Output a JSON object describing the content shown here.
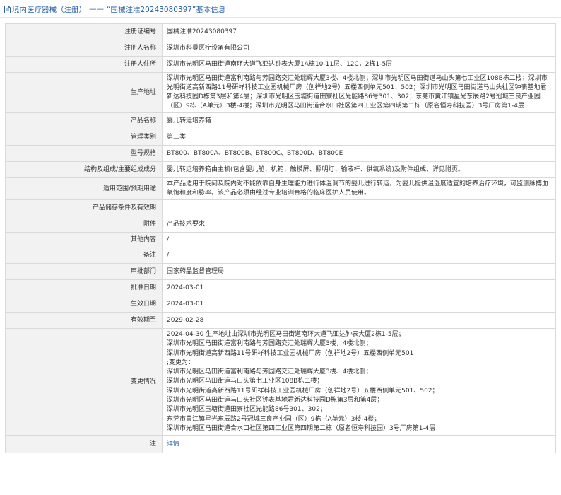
{
  "breadcrumb": {
    "part1": "境内医疗器械（注册）",
    "separator": "——",
    "part2": "“国械注准20243080397”基本信息"
  },
  "rows": [
    {
      "key": "注册证编号",
      "value": "国械注准20243080397"
    },
    {
      "key": "注册人名称",
      "value": "深圳市科曼医疗设备有限公司"
    },
    {
      "key": "注册人住所",
      "value": "深圳市光明区马田街道南环大道飞亚达钟表大厦1A栋10-11层、12C，2栋1-5层"
    },
    {
      "key": "生产地址",
      "value": "深圳市光明区马田街道富利南路与芳园路交汇处瑞辉大厦3楼、4楼北侧；深圳市光明区马田街道马山头第七工业区108B栋二楼；深圳市光明街道高新西路11号研祥科技工业园机械厂房（创祥地2号）五楼西侧单元501、502；深圳市光明区马田街道马山头社区钟表基地君新达科技园D栋第3层和第4层；深圳市光明区玉塘街道田寮社区光能路86号301、302；东莞市黄江镇星光东辰路2号冠城三良产业园（区）9栋（A单元）3楼-4楼；深圳市光明区马田街道合水口社区第四工业区第四期第二栋（原名恒寿科技园）3号厂房第1-4层"
    },
    {
      "key": "产品名称",
      "value": "婴儿转运培养箱"
    },
    {
      "key": "管理类别",
      "value": "第三类"
    },
    {
      "key": "型号规格",
      "value": "BT800、BT800A、BT800B、BT800C、BT800D、BT800E"
    },
    {
      "key": "结构及组成/主要组成成分",
      "value": "婴儿转运培养箱由主机(包含婴儿舱、机箱、触摸屏、照明灯、输液杆、供氧系统)及附件组成，详见附页。"
    },
    {
      "key": "适用范围/预期用途",
      "value": "本产品适用于院间及院内对不能依靠自身生理能力进行体温调节的婴儿进行转运，为婴儿提供温湿度适宜的培养治疗环境，可监测脉搏血氧饱和度和脉率。该产品必须由经过专业培训合格的临床医护人员使用。"
    },
    {
      "key": "产品储存条件及有效期",
      "value": ""
    },
    {
      "key": "附件",
      "value": "产品技术要求"
    },
    {
      "key": "其他内容",
      "value": "/"
    },
    {
      "key": "备注",
      "value": "/"
    },
    {
      "key": "审批部门",
      "value": "国家药品监督管理局"
    },
    {
      "key": "批准日期",
      "value": "2024-03-01"
    },
    {
      "key": "生效日期",
      "value": "2024-03-01"
    },
    {
      "key": "有效期至",
      "value": "2029-02-28"
    }
  ],
  "changes": {
    "key": "变更情况",
    "lines": [
      "2024-04-30 生产地址由深圳市光明区马田街道南环大道飞亚达钟表大厦2栋1-5层；",
      "深圳市光明区马田街道富利南路与芳园路交汇处瑞辉大厦3楼，4楼北侧；",
      "深圳市光明街道高新西路11号研祥科技工业园机械厂房（创祥地2号）五楼西侧单元501",
      ";变更为：",
      "深圳市光明区马田街道富利南路与芳园路交汇处瑞辉大厦3楼、4楼北侧；",
      "深圳市光明区马田街道马山头第七工业区108B栋二楼；",
      "深圳市光明街道高新西路11号研祥科技工业园机械厂房（创祥地2号）五楼西侧单元501、502；",
      "深圳市光明区马田街道马山头社区钟表基地君新达科技园D栋第3层和第4层；",
      "深圳市光明区玉塘街道田寮社区光能路86号301、302；",
      "东莞市黄江镇星光东辰路2号冠城三良产业园（区）9栋（A单元）3楼-4楼；",
      "深圳市光明区马田街道合水口社区第四工业区第四期第二栋（原名恒寿科技园）3号厂房第1-4层"
    ]
  },
  "notes": {
    "key": "注",
    "link_text": "详情"
  },
  "colors": {
    "link": "#2a62a8",
    "key_bg": "#f2f2f2",
    "border": "#d9d9d9"
  }
}
